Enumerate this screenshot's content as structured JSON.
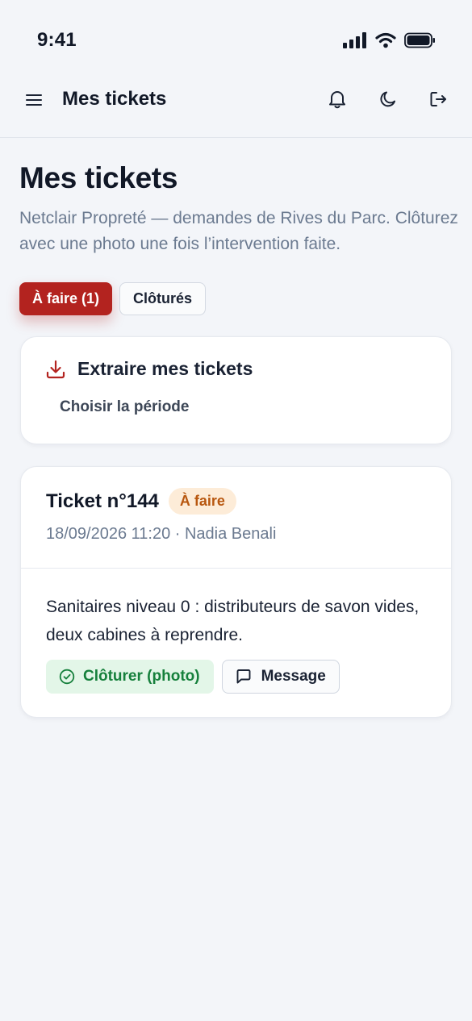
{
  "status_bar": {
    "time": "9:41",
    "icons": [
      "signal-icon",
      "wifi-icon",
      "battery-icon"
    ]
  },
  "header": {
    "title": "Mes tickets",
    "icons": [
      "menu-icon",
      "bell-icon",
      "moon-icon",
      "logout-icon"
    ]
  },
  "page": {
    "title": "Mes tickets",
    "subtitle": "Netclair Propreté — demandes de Rives du Parc. Clôturez avec une photo une fois l’intervention faite."
  },
  "filters": {
    "active_label": "À faire (1)",
    "closed_label": "Clôturés"
  },
  "export": {
    "title": "Extraire mes tickets",
    "period_label": "Choisir la période",
    "icon": "download-icon"
  },
  "tickets": [
    {
      "title": "Ticket n°144",
      "status": "À faire",
      "meta": "18/09/2026 11:20 · Nadia Benali",
      "description": "Sanitaires niveau 0 : distributeurs de savon vides, deux cabines à reprendre.",
      "close_label": "Clôturer (photo)",
      "message_label": "Message"
    }
  ],
  "colors": {
    "accent": "#b3231f",
    "badge_bg": "#fdecd8",
    "badge_text": "#b8570f",
    "success_bg": "#e3f6e8",
    "success_text": "#16803c",
    "background": "#f3f5f9"
  }
}
